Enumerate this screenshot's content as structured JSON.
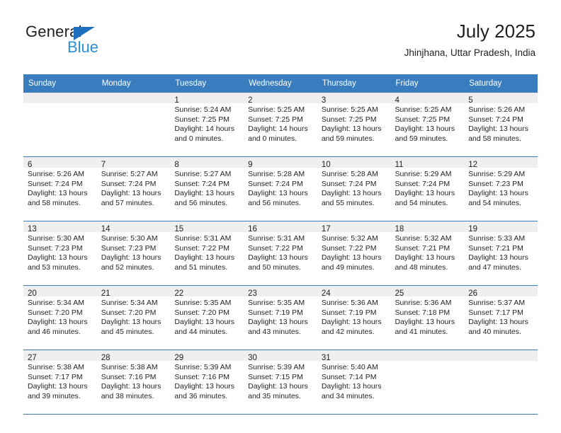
{
  "brand": {
    "name_top": "General",
    "name_bottom": "Blue",
    "triangle_color": "#1f6fc0",
    "blue_color": "#2b8fd6"
  },
  "header": {
    "title": "July 2025",
    "subtitle": "Jhinjhana, Uttar Pradesh, India"
  },
  "theme": {
    "header_blue": "#3a7dbf",
    "daynum_band": "#efefef",
    "text": "#231f20"
  },
  "weekdays": [
    "Sunday",
    "Monday",
    "Tuesday",
    "Wednesday",
    "Thursday",
    "Friday",
    "Saturday"
  ],
  "labels": {
    "sunrise_prefix": "Sunrise:",
    "sunset_prefix": "Sunset:",
    "daylight_prefix": "Daylight:"
  },
  "weeks": [
    [
      {
        "day": ""
      },
      {
        "day": ""
      },
      {
        "day": "1",
        "sunrise": "Sunrise: 5:24 AM",
        "sunset": "Sunset: 7:25 PM",
        "daylight_l1": "Daylight: 14 hours",
        "daylight_l2": "and 0 minutes."
      },
      {
        "day": "2",
        "sunrise": "Sunrise: 5:25 AM",
        "sunset": "Sunset: 7:25 PM",
        "daylight_l1": "Daylight: 14 hours",
        "daylight_l2": "and 0 minutes."
      },
      {
        "day": "3",
        "sunrise": "Sunrise: 5:25 AM",
        "sunset": "Sunset: 7:25 PM",
        "daylight_l1": "Daylight: 13 hours",
        "daylight_l2": "and 59 minutes."
      },
      {
        "day": "4",
        "sunrise": "Sunrise: 5:25 AM",
        "sunset": "Sunset: 7:25 PM",
        "daylight_l1": "Daylight: 13 hours",
        "daylight_l2": "and 59 minutes."
      },
      {
        "day": "5",
        "sunrise": "Sunrise: 5:26 AM",
        "sunset": "Sunset: 7:24 PM",
        "daylight_l1": "Daylight: 13 hours",
        "daylight_l2": "and 58 minutes."
      }
    ],
    [
      {
        "day": "6",
        "sunrise": "Sunrise: 5:26 AM",
        "sunset": "Sunset: 7:24 PM",
        "daylight_l1": "Daylight: 13 hours",
        "daylight_l2": "and 58 minutes."
      },
      {
        "day": "7",
        "sunrise": "Sunrise: 5:27 AM",
        "sunset": "Sunset: 7:24 PM",
        "daylight_l1": "Daylight: 13 hours",
        "daylight_l2": "and 57 minutes."
      },
      {
        "day": "8",
        "sunrise": "Sunrise: 5:27 AM",
        "sunset": "Sunset: 7:24 PM",
        "daylight_l1": "Daylight: 13 hours",
        "daylight_l2": "and 56 minutes."
      },
      {
        "day": "9",
        "sunrise": "Sunrise: 5:28 AM",
        "sunset": "Sunset: 7:24 PM",
        "daylight_l1": "Daylight: 13 hours",
        "daylight_l2": "and 56 minutes."
      },
      {
        "day": "10",
        "sunrise": "Sunrise: 5:28 AM",
        "sunset": "Sunset: 7:24 PM",
        "daylight_l1": "Daylight: 13 hours",
        "daylight_l2": "and 55 minutes."
      },
      {
        "day": "11",
        "sunrise": "Sunrise: 5:29 AM",
        "sunset": "Sunset: 7:24 PM",
        "daylight_l1": "Daylight: 13 hours",
        "daylight_l2": "and 54 minutes."
      },
      {
        "day": "12",
        "sunrise": "Sunrise: 5:29 AM",
        "sunset": "Sunset: 7:23 PM",
        "daylight_l1": "Daylight: 13 hours",
        "daylight_l2": "and 54 minutes."
      }
    ],
    [
      {
        "day": "13",
        "sunrise": "Sunrise: 5:30 AM",
        "sunset": "Sunset: 7:23 PM",
        "daylight_l1": "Daylight: 13 hours",
        "daylight_l2": "and 53 minutes."
      },
      {
        "day": "14",
        "sunrise": "Sunrise: 5:30 AM",
        "sunset": "Sunset: 7:23 PM",
        "daylight_l1": "Daylight: 13 hours",
        "daylight_l2": "and 52 minutes."
      },
      {
        "day": "15",
        "sunrise": "Sunrise: 5:31 AM",
        "sunset": "Sunset: 7:22 PM",
        "daylight_l1": "Daylight: 13 hours",
        "daylight_l2": "and 51 minutes."
      },
      {
        "day": "16",
        "sunrise": "Sunrise: 5:31 AM",
        "sunset": "Sunset: 7:22 PM",
        "daylight_l1": "Daylight: 13 hours",
        "daylight_l2": "and 50 minutes."
      },
      {
        "day": "17",
        "sunrise": "Sunrise: 5:32 AM",
        "sunset": "Sunset: 7:22 PM",
        "daylight_l1": "Daylight: 13 hours",
        "daylight_l2": "and 49 minutes."
      },
      {
        "day": "18",
        "sunrise": "Sunrise: 5:32 AM",
        "sunset": "Sunset: 7:21 PM",
        "daylight_l1": "Daylight: 13 hours",
        "daylight_l2": "and 48 minutes."
      },
      {
        "day": "19",
        "sunrise": "Sunrise: 5:33 AM",
        "sunset": "Sunset: 7:21 PM",
        "daylight_l1": "Daylight: 13 hours",
        "daylight_l2": "and 47 minutes."
      }
    ],
    [
      {
        "day": "20",
        "sunrise": "Sunrise: 5:34 AM",
        "sunset": "Sunset: 7:20 PM",
        "daylight_l1": "Daylight: 13 hours",
        "daylight_l2": "and 46 minutes."
      },
      {
        "day": "21",
        "sunrise": "Sunrise: 5:34 AM",
        "sunset": "Sunset: 7:20 PM",
        "daylight_l1": "Daylight: 13 hours",
        "daylight_l2": "and 45 minutes."
      },
      {
        "day": "22",
        "sunrise": "Sunrise: 5:35 AM",
        "sunset": "Sunset: 7:20 PM",
        "daylight_l1": "Daylight: 13 hours",
        "daylight_l2": "and 44 minutes."
      },
      {
        "day": "23",
        "sunrise": "Sunrise: 5:35 AM",
        "sunset": "Sunset: 7:19 PM",
        "daylight_l1": "Daylight: 13 hours",
        "daylight_l2": "and 43 minutes."
      },
      {
        "day": "24",
        "sunrise": "Sunrise: 5:36 AM",
        "sunset": "Sunset: 7:19 PM",
        "daylight_l1": "Daylight: 13 hours",
        "daylight_l2": "and 42 minutes."
      },
      {
        "day": "25",
        "sunrise": "Sunrise: 5:36 AM",
        "sunset": "Sunset: 7:18 PM",
        "daylight_l1": "Daylight: 13 hours",
        "daylight_l2": "and 41 minutes."
      },
      {
        "day": "26",
        "sunrise": "Sunrise: 5:37 AM",
        "sunset": "Sunset: 7:17 PM",
        "daylight_l1": "Daylight: 13 hours",
        "daylight_l2": "and 40 minutes."
      }
    ],
    [
      {
        "day": "27",
        "sunrise": "Sunrise: 5:38 AM",
        "sunset": "Sunset: 7:17 PM",
        "daylight_l1": "Daylight: 13 hours",
        "daylight_l2": "and 39 minutes."
      },
      {
        "day": "28",
        "sunrise": "Sunrise: 5:38 AM",
        "sunset": "Sunset: 7:16 PM",
        "daylight_l1": "Daylight: 13 hours",
        "daylight_l2": "and 38 minutes."
      },
      {
        "day": "29",
        "sunrise": "Sunrise: 5:39 AM",
        "sunset": "Sunset: 7:16 PM",
        "daylight_l1": "Daylight: 13 hours",
        "daylight_l2": "and 36 minutes."
      },
      {
        "day": "30",
        "sunrise": "Sunrise: 5:39 AM",
        "sunset": "Sunset: 7:15 PM",
        "daylight_l1": "Daylight: 13 hours",
        "daylight_l2": "and 35 minutes."
      },
      {
        "day": "31",
        "sunrise": "Sunrise: 5:40 AM",
        "sunset": "Sunset: 7:14 PM",
        "daylight_l1": "Daylight: 13 hours",
        "daylight_l2": "and 34 minutes."
      },
      {
        "day": ""
      },
      {
        "day": ""
      }
    ]
  ]
}
